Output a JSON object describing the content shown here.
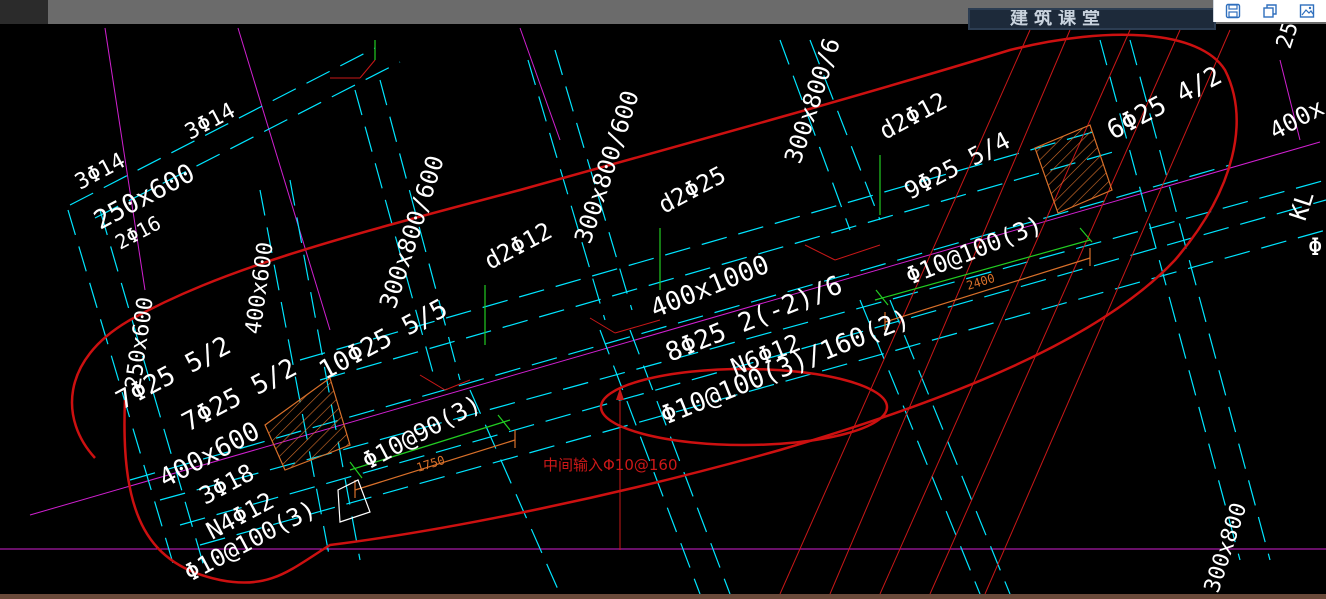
{
  "app": {
    "banner_text": "建筑课堂",
    "toolbar": {
      "icons": [
        "save-icon",
        "restore-window-icon",
        "screenshot-icon"
      ]
    }
  },
  "drawing": {
    "labels": {
      "l_3phi14_a": "3Φ14",
      "l_3phi14_b": "3Φ14",
      "l_250x600_a": "250x600",
      "l_2phi16": "2Φ16",
      "l_400x600_left": "400x600",
      "l_250x600_b": "250x600",
      "l_7phi25_a": "7Φ25 5/2",
      "l_7phi25_b": "7Φ25 5/2",
      "l_400x600_b": "400x600",
      "l_3phi18": "3Φ18",
      "l_n4phi12": "N4Φ12",
      "l_phi10_100_3_left": "Φ10@100(3)",
      "l_300x800_a": "300x800/600",
      "l_300x800_b": "300x800/600",
      "l_300x800_c": "300x800/6",
      "l_d2phi12_a": "d2Φ12",
      "l_d2phi25": "d2Φ25",
      "l_d2phi12_b": "d2Φ12",
      "l_10phi25": "10Φ25 5/5",
      "l_phi10_90": "Φ10@90(3)",
      "dim_1750": "1750",
      "l_400x1000": "400x1000",
      "l_8phi25": "8Φ25 2(-2)/6",
      "l_n6phi12": "N6Φ12",
      "l_mixed_stirrup": "Φ10@100(3)/160(2)",
      "l_9phi25": "9Φ25 5/4",
      "l_phi10_100_3_right": "Φ10@100(3)",
      "dim_2400": "2400",
      "l_6phi25": "6Φ25 4/2",
      "l_400x_right": "400x",
      "l_kl": "KL",
      "l_phi_right": "Φ",
      "l_300x800_bottom": "300x800",
      "l_25_top": "25"
    },
    "annotation_text": "中间输入Φ10@160",
    "colors": {
      "background": "#000000",
      "cyan": "#00e5ff",
      "magenta": "#d020d0",
      "red": "#d01818",
      "green": "#22cc22",
      "orange": "#d8702a",
      "white": "#ffffff"
    }
  }
}
